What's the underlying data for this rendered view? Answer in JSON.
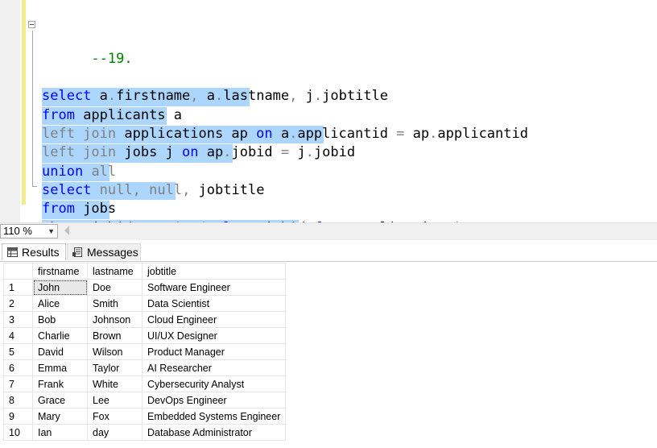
{
  "editor": {
    "comment": "--19.",
    "lines": [
      [
        {
          "t": "select",
          "c": "kw"
        },
        {
          "t": " a",
          "c": "id"
        },
        {
          "t": ".",
          "c": "op"
        },
        {
          "t": "firstname",
          "c": "id"
        },
        {
          "t": ",",
          "c": "op"
        },
        {
          "t": " a",
          "c": "id"
        },
        {
          "t": ".",
          "c": "op"
        },
        {
          "t": "lastname",
          "c": "id"
        },
        {
          "t": ",",
          "c": "op"
        },
        {
          "t": " j",
          "c": "id"
        },
        {
          "t": ".",
          "c": "op"
        },
        {
          "t": "jobtitle",
          "c": "id"
        }
      ],
      [
        {
          "t": "from",
          "c": "kw"
        },
        {
          "t": " applicants a",
          "c": "id"
        }
      ],
      [
        {
          "t": "left join",
          "c": "op"
        },
        {
          "t": " applications ap ",
          "c": "id"
        },
        {
          "t": "on",
          "c": "kw"
        },
        {
          "t": " a",
          "c": "id"
        },
        {
          "t": ".",
          "c": "op"
        },
        {
          "t": "applicantid ",
          "c": "id"
        },
        {
          "t": "=",
          "c": "op"
        },
        {
          "t": " ap",
          "c": "id"
        },
        {
          "t": ".",
          "c": "op"
        },
        {
          "t": "applicantid",
          "c": "id"
        }
      ],
      [
        {
          "t": "left join",
          "c": "op"
        },
        {
          "t": " jobs j ",
          "c": "id"
        },
        {
          "t": "on",
          "c": "kw"
        },
        {
          "t": " ap",
          "c": "id"
        },
        {
          "t": ".",
          "c": "op"
        },
        {
          "t": "jobid ",
          "c": "id"
        },
        {
          "t": "=",
          "c": "op"
        },
        {
          "t": " j",
          "c": "id"
        },
        {
          "t": ".",
          "c": "op"
        },
        {
          "t": "jobid",
          "c": "id"
        }
      ],
      [
        {
          "t": "union",
          "c": "kw"
        },
        {
          "t": " ",
          "c": "id"
        },
        {
          "t": "all",
          "c": "op"
        }
      ],
      [
        {
          "t": "select",
          "c": "kw"
        },
        {
          "t": " ",
          "c": "id"
        },
        {
          "t": "null",
          "c": "op"
        },
        {
          "t": ", ",
          "c": "op"
        },
        {
          "t": "null",
          "c": "op"
        },
        {
          "t": ",",
          "c": "op"
        },
        {
          "t": " jobtitle",
          "c": "id"
        }
      ],
      [
        {
          "t": "from",
          "c": "kw"
        },
        {
          "t": " jobs",
          "c": "id"
        }
      ],
      [
        {
          "t": "where",
          "c": "kw"
        },
        {
          "t": " jobid ",
          "c": "id"
        },
        {
          "t": "not in",
          "c": "op"
        },
        {
          "t": " ",
          "c": "id"
        },
        {
          "t": "(",
          "c": "op"
        },
        {
          "t": "select",
          "c": "kw"
        },
        {
          "t": " jobid ",
          "c": "id"
        },
        {
          "t": "from",
          "c": "kw"
        },
        {
          "t": " applications",
          "c": "id"
        },
        {
          "t": ")",
          "c": "op"
        }
      ]
    ],
    "selection_widths_chars": [
      25,
      15,
      34,
      23,
      8,
      16,
      8,
      31
    ]
  },
  "zoom": {
    "value": "110 %"
  },
  "tabs": {
    "results_label": "Results",
    "messages_label": "Messages"
  },
  "results": {
    "columns": [
      "firstname",
      "lastname",
      "jobtitle"
    ],
    "rows": [
      [
        "1",
        "John",
        "Doe",
        "Software Engineer"
      ],
      [
        "2",
        "Alice",
        "Smith",
        "Data Scientist"
      ],
      [
        "3",
        "Bob",
        "Johnson",
        "Cloud Engineer"
      ],
      [
        "4",
        "Charlie",
        "Brown",
        "UI/UX Designer"
      ],
      [
        "5",
        "David",
        "Wilson",
        "Product Manager"
      ],
      [
        "6",
        "Emma",
        "Taylor",
        "AI Researcher"
      ],
      [
        "7",
        "Frank",
        "White",
        "Cybersecurity Analyst"
      ],
      [
        "8",
        "Grace",
        "Lee",
        "DevOps Engineer"
      ],
      [
        "9",
        "Mary",
        "Fox",
        "Embedded Systems Engineer"
      ],
      [
        "10",
        "Ian",
        "day",
        "Database Administrator"
      ]
    ]
  }
}
